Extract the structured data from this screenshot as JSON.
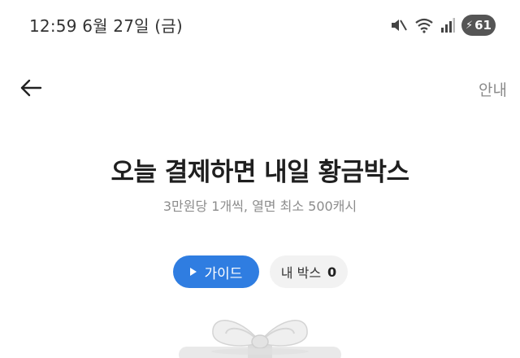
{
  "status_bar": {
    "time_date": "12:59  6월 27일 (금)",
    "battery_level": "61",
    "icons": [
      "mute-icon",
      "wifi-icon",
      "signal-icon",
      "battery-charging-icon"
    ]
  },
  "header": {
    "info_label": "안내"
  },
  "hero": {
    "title": "오늘 결제하면 내일 황금박스",
    "subtitle": "3만원당 1개씩, 열면 최소 500캐시"
  },
  "actions": {
    "guide_label": "가이드",
    "mybox_label": "내 박스",
    "mybox_count": "0"
  },
  "colors": {
    "accent": "#2f7de1",
    "pill_bg": "#f2f2f2",
    "subtitle": "#8c8c8c"
  }
}
